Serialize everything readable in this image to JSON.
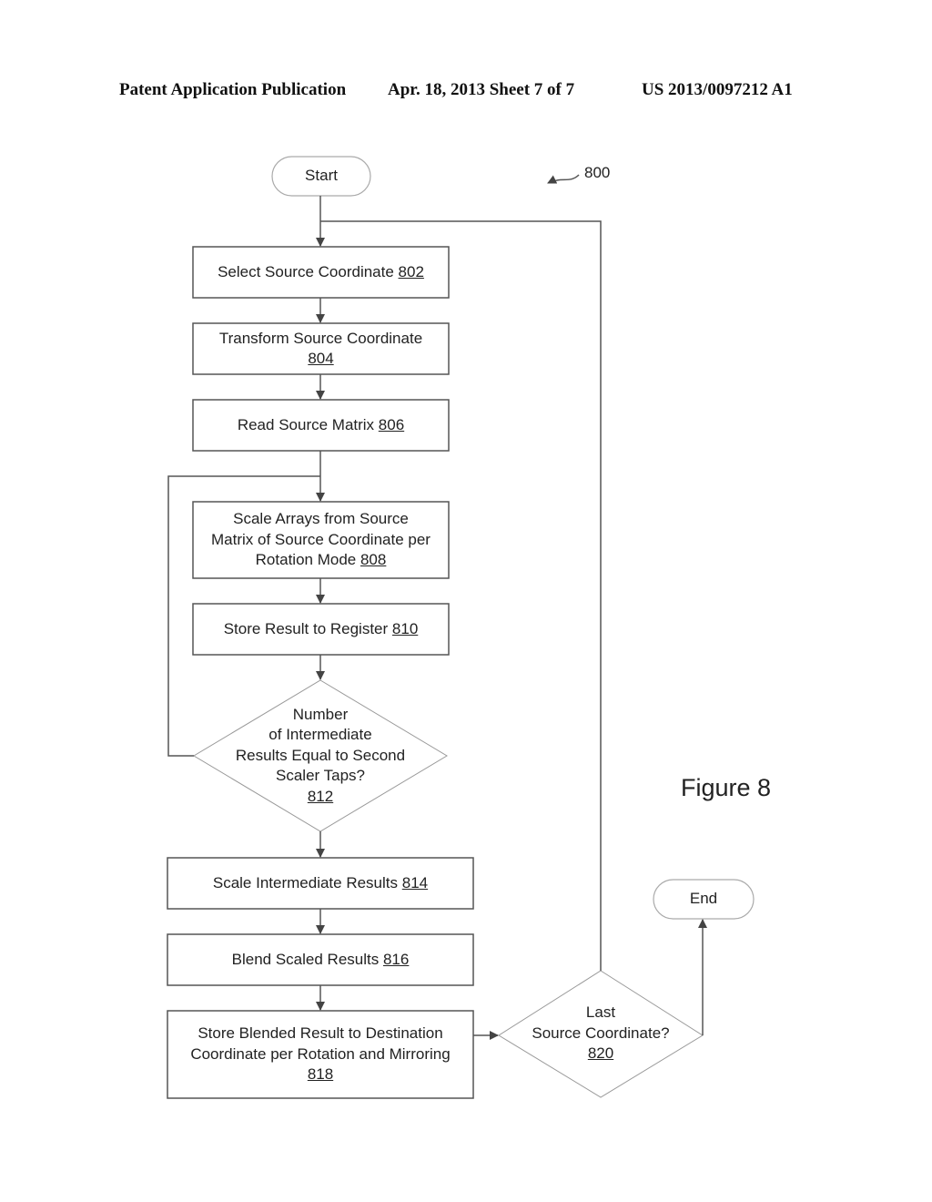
{
  "header": {
    "publication": "Patent Application Publication",
    "date_sheet": "Apr. 18, 2013  Sheet 7 of 7",
    "patent_number": "US 2013/0097212 A1"
  },
  "figure": {
    "label": "Figure 8",
    "reference": "800"
  },
  "colors": {
    "line": "#555555",
    "text": "#222222",
    "terminator_border": "#999999"
  },
  "nodes": {
    "start": {
      "text": "Start"
    },
    "n802": {
      "lines": [
        "Select Source Coordinate"
      ],
      "ref": "802"
    },
    "n804": {
      "lines": [
        "Transform Source Coordinate"
      ],
      "ref": "804"
    },
    "n806": {
      "lines": [
        "Read Source Matrix"
      ],
      "ref": "806"
    },
    "n808": {
      "lines": [
        "Scale Arrays from Source",
        "Matrix of Source Coordinate per",
        "Rotation Mode"
      ],
      "ref": "808"
    },
    "n810": {
      "lines": [
        "Store Result to Register"
      ],
      "ref": "810"
    },
    "n812": {
      "lines": [
        "Number",
        "of Intermediate",
        "Results Equal to Second",
        "Scaler Taps?"
      ],
      "ref": "812"
    },
    "n814": {
      "lines": [
        "Scale Intermediate Results"
      ],
      "ref": "814"
    },
    "n816": {
      "lines": [
        "Blend Scaled Results"
      ],
      "ref": "816"
    },
    "n818": {
      "lines": [
        "Store Blended Result to Destination",
        "Coordinate per Rotation and Mirroring"
      ],
      "ref": "818"
    },
    "n820": {
      "lines": [
        "Last",
        "Source Coordinate?"
      ],
      "ref": "820"
    },
    "end": {
      "text": "End"
    }
  },
  "edges": [
    {
      "from": "start",
      "to": "n802"
    },
    {
      "from": "n802",
      "to": "n804"
    },
    {
      "from": "n804",
      "to": "n806"
    },
    {
      "from": "n806",
      "to": "n808"
    },
    {
      "from": "n808",
      "to": "n810"
    },
    {
      "from": "n810",
      "to": "n812"
    },
    {
      "from": "n812",
      "to": "n808",
      "label": ""
    },
    {
      "from": "n812",
      "to": "n814"
    },
    {
      "from": "n814",
      "to": "n816"
    },
    {
      "from": "n816",
      "to": "n818"
    },
    {
      "from": "n818",
      "to": "n820"
    },
    {
      "from": "n820",
      "to": "end"
    },
    {
      "from": "n820",
      "to": "n802"
    }
  ]
}
